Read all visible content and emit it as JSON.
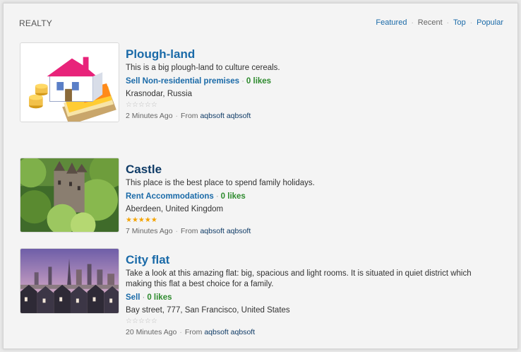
{
  "header": {
    "title": "REALTY",
    "tabs": [
      {
        "label": "Featured",
        "active": false
      },
      {
        "label": "Recent",
        "active": true
      },
      {
        "label": "Top",
        "active": false
      },
      {
        "label": "Popular",
        "active": false
      }
    ]
  },
  "items": [
    {
      "title": "Plough-land",
      "description": "This is a big plough-land to culture cereals.",
      "category": "Sell Non-residential premises",
      "likes": "0 likes",
      "location": "Krasnodar, Russia",
      "rating": 0,
      "stars": "☆☆☆☆☆",
      "time": "2 Minutes Ago",
      "from_label": "From",
      "author": "aqbsoft aqbsoft",
      "thumb_icon": "house-money-icon"
    },
    {
      "title": "Castle",
      "description": "This place is the best place to spend family holidays.",
      "category": "Rent Accommodations",
      "likes": "0 likes",
      "location": "Aberdeen, United Kingdom",
      "rating": 5,
      "stars": "★★★★★",
      "time": "7 Minutes Ago",
      "from_label": "From",
      "author": "aqbsoft aqbsoft",
      "thumb_icon": "castle-photo"
    },
    {
      "title": "City flat",
      "description_line1": "Take a look at this amazing flat: big, spacious and light rooms. It is situated in quiet district which",
      "description_line2": "making this flat a best choice for a family.",
      "category": "Sell",
      "likes": "0 likes",
      "location": "Bay street, 777, San Francisco, United States",
      "rating": 0,
      "stars": "☆☆☆☆☆",
      "time": "20 Minutes Ago",
      "from_label": "From",
      "author": "aqbsoft aqbsoft",
      "thumb_icon": "city-photo"
    }
  ],
  "separator": "·"
}
